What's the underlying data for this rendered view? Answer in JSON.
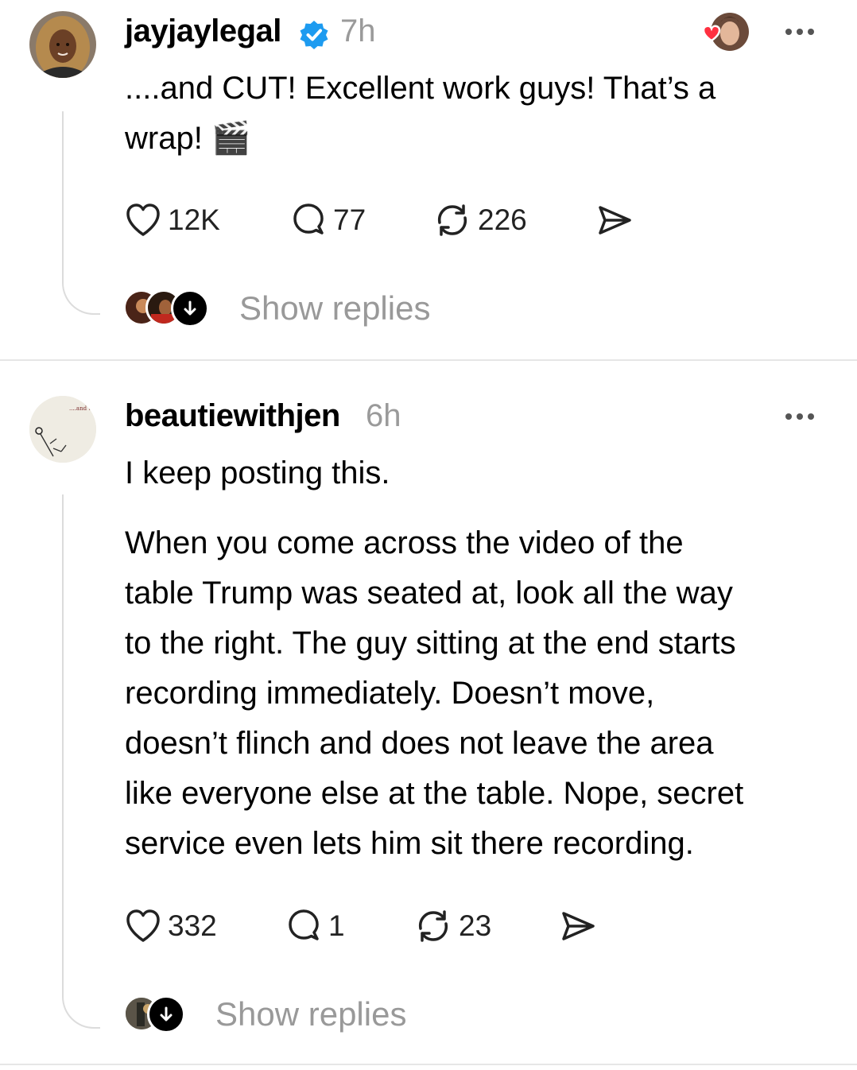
{
  "posts": [
    {
      "username": "jayjaylegal",
      "verified": true,
      "time": "7h",
      "text_lines": [
        "....and CUT! Excellent work guys! That’s a",
        "wrap! 🎬"
      ],
      "likes": "12K",
      "comments": "77",
      "reposts": "226",
      "show_replies": "Show replies",
      "icons": {
        "like": "heart-icon",
        "comment": "comment-bubble-icon",
        "repost": "repost-icon",
        "share": "send-icon",
        "more": "more-icon"
      }
    },
    {
      "username": "beautiewithjen",
      "verified": false,
      "time": "6h",
      "avatar_caption": "....and then she said.",
      "paragraph1": "I keep posting this.",
      "paragraph2_lines": [
        "When you come across the video of the",
        "table Trump was seated at, look all the way",
        "to the right. The guy sitting at the end starts",
        "recording immediately. Doesn’t move,",
        "doesn’t flinch and does not leave the area",
        "like everyone else at the table. Nope, secret",
        "service even lets him sit there recording."
      ],
      "likes": "332",
      "comments": "1",
      "reposts": "23",
      "show_replies": "Show replies"
    }
  ],
  "colors": {
    "verified_blue": "#1d9bf0",
    "heart_red": "#ff3040",
    "muted": "#999999"
  }
}
